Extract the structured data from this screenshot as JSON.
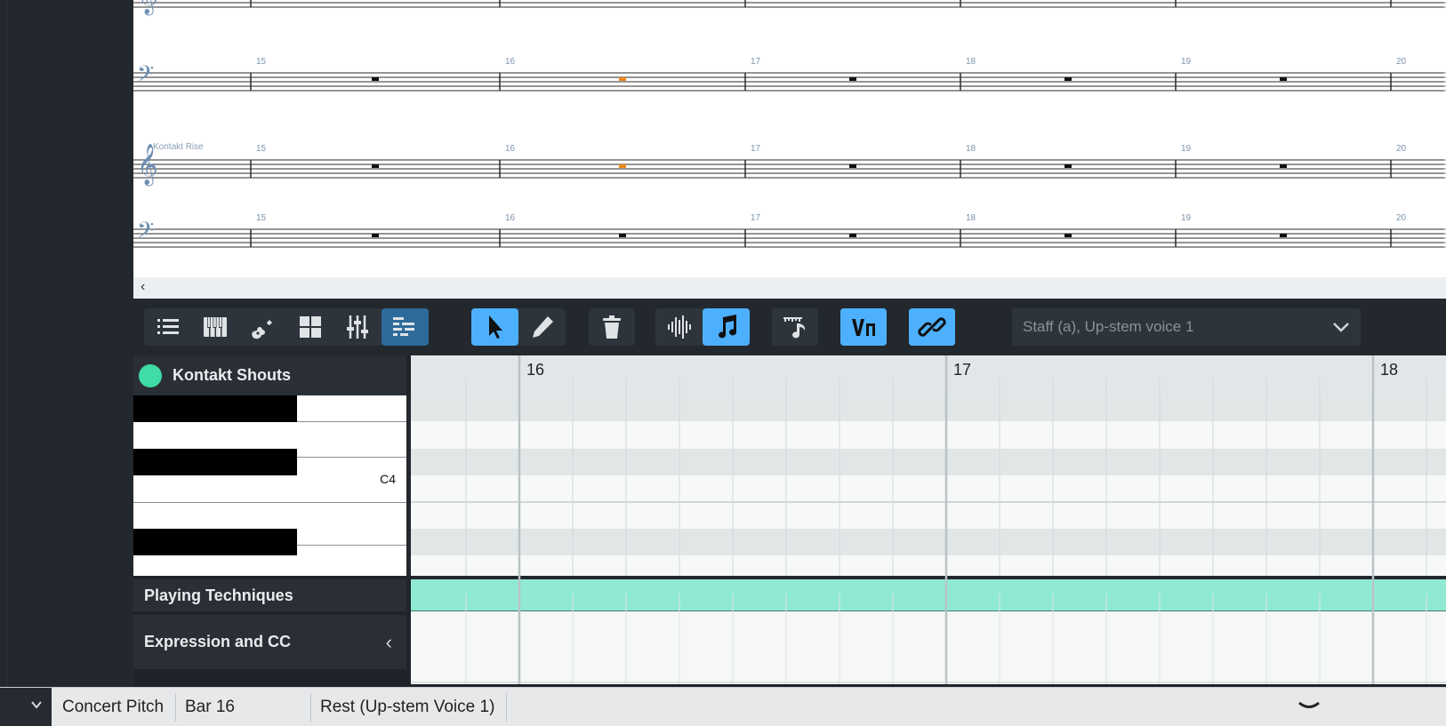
{
  "score": {
    "system1": {
      "bar_numbers": [
        "15",
        "16",
        "17",
        "18",
        "19",
        "20"
      ]
    },
    "system2": {
      "instrument_label": "Kontakt Rise",
      "bar_numbers": [
        "15",
        "16",
        "17",
        "18",
        "19",
        "20"
      ]
    },
    "scroll_left_icon": "chevron-left-icon"
  },
  "toolbar": {
    "panel_buttons": [
      {
        "icon": "list-icon"
      },
      {
        "icon": "piano-keys-icon"
      },
      {
        "icon": "guitar-icon"
      },
      {
        "icon": "grid-icon"
      },
      {
        "icon": "mixer-sliders-icon"
      },
      {
        "icon": "key-editor-icon",
        "active": true
      }
    ],
    "tool_buttons": [
      {
        "icon": "arrow-select-icon",
        "active": true
      },
      {
        "icon": "pencil-icon"
      }
    ],
    "delete_icon": "trash-icon",
    "view_buttons": [
      {
        "icon": "waveform-icon"
      },
      {
        "icon": "music-note-icon",
        "active": true
      }
    ],
    "note_ruler_icon": "note-ruler-icon",
    "voice_toggle_icon": "voice-icon",
    "link_icon": "link-icon",
    "staff_selector": "Staff (a), Up-stem voice 1"
  },
  "key_editor": {
    "instrument_name": "Kontakt Shouts",
    "instrument_color": "#3fdca6",
    "c4_label": "C4",
    "bar_numbers": [
      "16",
      "17",
      "18"
    ],
    "lanes": {
      "playing_techniques": "Playing Techniques",
      "expression_cc": "Expression and CC"
    },
    "lane_color": "#90ead3"
  },
  "statusbar": {
    "concert_pitch": "Concert Pitch",
    "bar": "Bar 16",
    "selection": "Rest (Up-stem Voice 1)"
  }
}
